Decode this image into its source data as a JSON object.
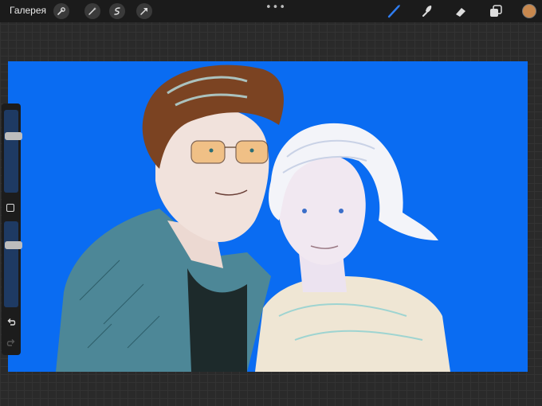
{
  "toolbar": {
    "gallery_label": "Галерея",
    "left_tools": [
      {
        "name": "wrench-icon"
      },
      {
        "name": "magic-wand-icon"
      },
      {
        "name": "selection-icon"
      },
      {
        "name": "transform-arrow-icon"
      }
    ],
    "more_glyph": "•••",
    "right_tools": [
      {
        "name": "brush-icon",
        "active": true
      },
      {
        "name": "smudge-icon"
      },
      {
        "name": "eraser-icon"
      },
      {
        "name": "layers-icon"
      }
    ],
    "current_color": "#c8884e",
    "accent_color": "#2f7df0"
  },
  "canvas": {
    "background_color": "#0a6cf2"
  },
  "sidebar": {
    "brush_size_level": 0.7,
    "opacity_level": 0.75
  }
}
